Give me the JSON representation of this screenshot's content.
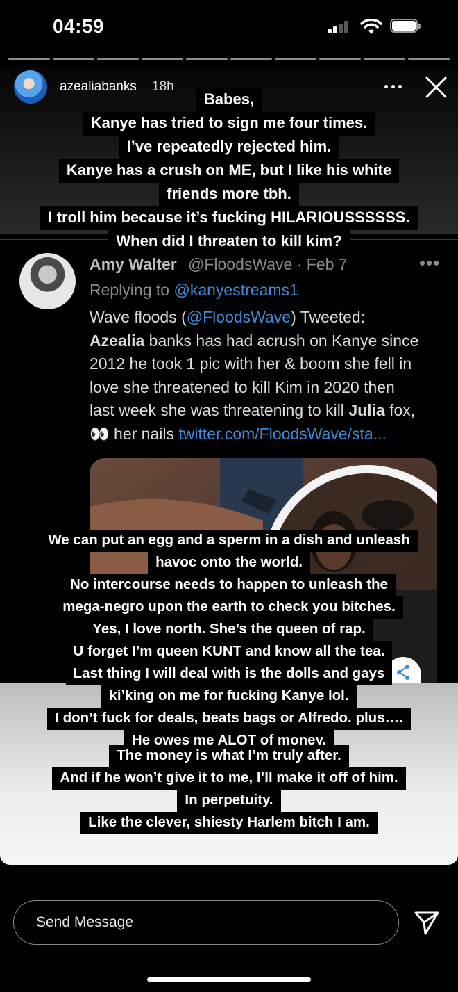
{
  "status_bar": {
    "time": "04:59"
  },
  "story": {
    "username": "azealiabanks",
    "time_ago": "18h",
    "more_icon": "more-horizontal-icon",
    "close_icon": "close-icon",
    "progress_segments": 10
  },
  "caption_top": [
    "Babes,",
    "Kanye has tried to sign me four times.",
    "I’ve repeatedly rejected him.",
    "Kanye has a crush on ME, but I like his white",
    "friends more tbh.",
    "I troll him because it’s fucking HILARIOUSSSSSS.",
    "When did I threaten to kill kim?"
  ],
  "tweet": {
    "name": "Amy Walter",
    "handle": "@FloodsWave · Feb 7",
    "replying_prefix": "Replying to ",
    "replying_user": "@kanyestreams1",
    "body": {
      "l1_a": "Wave floods (",
      "l1_link": "@FloodsWave",
      "l1_b": ") Tweeted:",
      "l2_bold": "Azealia",
      "l2_rest": " banks has had acrush on Kanye since",
      "l3": "2012 he took 1 pic with her & boom she fell in",
      "l4": "love she threatened to kill Kim in 2020 then",
      "l5_a": "last week she was threatening to kill ",
      "l5_bold": "Julia",
      "l5_b": " fox,",
      "l6_a": "👀 her nails  ",
      "l6_link": "twitter.com/FloodsWave/sta..."
    }
  },
  "caption_mid": [
    "We can put an egg and a sperm in a dish and unleash",
    "havoc onto the world.",
    "No intercourse needs to happen to unleash the",
    "mega-negro upon the earth to check you bitches.",
    "Yes, I love north. She’s  the queen of rap.",
    "U forget I’m queen KUNT and know all the tea.",
    "Last thing I will deal with is the dolls and gays",
    "ki’king on me for fucking Kanye lol.",
    "I don’t fuck for deals, beats bags or Alfredo. plus….",
    "He owes me ALOT of money."
  ],
  "caption_bottom": [
    "The money is what I’m truly after.",
    "And if he won’t give it to me, I’ll make it off of him.",
    "In perpetuity.",
    "Like the clever, shiesty Harlem bitch I am."
  ],
  "message_bar": {
    "placeholder": "Send Message"
  }
}
